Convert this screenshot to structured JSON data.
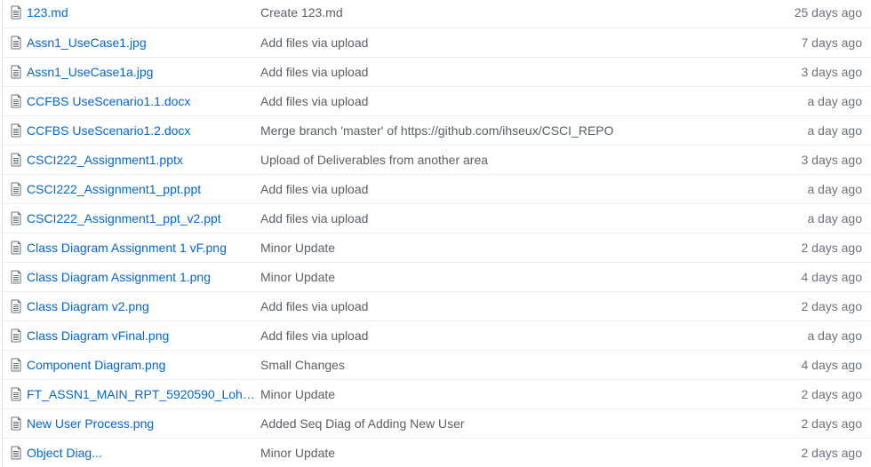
{
  "files": [
    {
      "name": "123.md",
      "message": "Create 123.md",
      "age": "25 days ago",
      "icon": "file-icon"
    },
    {
      "name": "Assn1_UseCase1.jpg",
      "message": "Add files via upload",
      "age": "7 days ago",
      "icon": "file-icon"
    },
    {
      "name": "Assn1_UseCase1a.jpg",
      "message": "Add files via upload",
      "age": "3 days ago",
      "icon": "file-icon"
    },
    {
      "name": "CCFBS UseScenario1.1.docx",
      "message": "Add files via upload",
      "age": "a day ago",
      "icon": "file-icon"
    },
    {
      "name": "CCFBS UseScenario1.2.docx",
      "message": "Merge branch 'master' of https://github.com/ihseux/CSCI_REPO",
      "age": "a day ago",
      "icon": "file-icon"
    },
    {
      "name": "CSCI222_Assignment1.pptx",
      "message": "Upload of Deliverables from another area",
      "age": "3 days ago",
      "icon": "file-icon"
    },
    {
      "name": "CSCI222_Assignment1_ppt.ppt",
      "message": "Add files via upload",
      "age": "a day ago",
      "icon": "file-icon"
    },
    {
      "name": "CSCI222_Assignment1_ppt_v2.ppt",
      "message": "Add files via upload",
      "age": "a day ago",
      "icon": "file-icon"
    },
    {
      "name": "Class Diagram Assignment 1 vF.png",
      "message": "Minor Update",
      "age": "2 days ago",
      "icon": "file-icon"
    },
    {
      "name": "Class Diagram Assignment 1.png",
      "message": "Minor Update",
      "age": "4 days ago",
      "icon": "file-icon"
    },
    {
      "name": "Class Diagram v2.png",
      "message": "Add files via upload",
      "age": "2 days ago",
      "icon": "file-icon"
    },
    {
      "name": "Class Diagram vFinal.png",
      "message": "Add files via upload",
      "age": "a day ago",
      "icon": "file-icon"
    },
    {
      "name": "Component Diagram.png",
      "message": "Small Changes",
      "age": "4 days ago",
      "icon": "file-icon"
    },
    {
      "name": "FT_ASSN1_MAIN_RPT_5920590_LohHa...",
      "message": "Minor Update",
      "age": "2 days ago",
      "icon": "file-icon"
    },
    {
      "name": "New User Process.png",
      "message": "Added Seq Diag of Adding New User",
      "age": "2 days ago",
      "icon": "file-icon"
    },
    {
      "name": "Object Diag...",
      "message": "Minor Update",
      "age": "2 days ago",
      "icon": "file-icon"
    }
  ],
  "colors": {
    "link": "#0366d6",
    "message": "#586069",
    "age": "#6a737d",
    "icon": "#6a737d",
    "border": "#eaecef"
  }
}
